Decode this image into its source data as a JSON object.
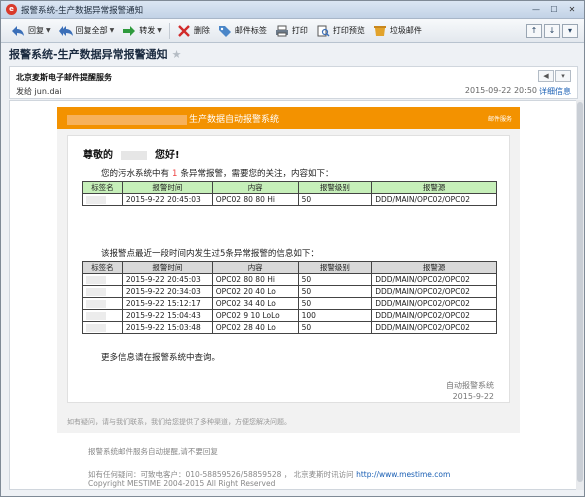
{
  "window": {
    "title": "报警系统-生产数据异常报警通知"
  },
  "toolbar": {
    "reply": "回复",
    "reply_all": "回复全部",
    "forward": "转发",
    "delete": "删除",
    "mail_tag": "邮件标签",
    "print": "打印",
    "print_preview": "打印预览",
    "junk": "垃圾邮件"
  },
  "subject": "报警系统-生产数据异常报警通知",
  "header": {
    "sender": "北京麦斯电子邮件提醒服务",
    "from": "发给 jun.dai",
    "date": "2015-09-22 20:50",
    "details": "详细信息"
  },
  "mail": {
    "header_title": "生产数据自动报警系统",
    "header_right": "邮件服务",
    "greeting_prefix": "尊敬的",
    "greeting_suffix": "您好!",
    "line1_prefix": "您的污水系统中有",
    "line1_count": "1",
    "line1_suffix": "条异常报警，需要您的关注，内容如下：",
    "line2": "该报警点最近一段时间内发生过5条异常报警的信息如下：",
    "more": "更多信息请在报警系统中查询。",
    "sig1": "自动报警系统",
    "sig2": "2015-9-22",
    "faq": "如有疑问，请与我们联系，我们给您提供了多种渠道，方便您解决问题。"
  },
  "table_headers": [
    "标签名",
    "报警时间",
    "内容",
    "报警级别",
    "报警源"
  ],
  "table1": [
    {
      "time": "2015-9-22 20:45:03",
      "content": "OPC02 80 80 Hi",
      "level": "50",
      "source": "DDD/MAIN/OPC02/OPC02"
    }
  ],
  "table2": [
    {
      "time": "2015-9-22 20:45:03",
      "content": "OPC02 80 80 Hi",
      "level": "50",
      "source": "DDD/MAIN/OPC02/OPC02"
    },
    {
      "time": "2015-9-22 20:34:03",
      "content": "OPC02 20 40 Lo",
      "level": "50",
      "source": "DDD/MAIN/OPC02/OPC02"
    },
    {
      "time": "2015-9-22 15:12:17",
      "content": "OPC02 34 40 Lo",
      "level": "50",
      "source": "DDD/MAIN/OPC02/OPC02"
    },
    {
      "time": "2015-9-22 15:04:43",
      "content": "OPC02 9 10 LoLo",
      "level": "100",
      "source": "DDD/MAIN/OPC02/OPC02"
    },
    {
      "time": "2015-9-22 15:03:48",
      "content": "OPC02 28 40 Lo",
      "level": "50",
      "source": "DDD/MAIN/OPC02/OPC02"
    }
  ],
  "footer": {
    "notice": "报警系统邮件服务自动提醒,请不要回复",
    "contact": "如有任何疑问：可致电客户：010-58859526/58859528 ， 北京麦斯时讯访问",
    "url": "http://www.mestime.com",
    "copyright": "Copyright MESTIME 2004-2015 All Right Reserved"
  },
  "colors": {
    "accent": "#f39200",
    "header_row_1": "#c6efb9",
    "header_row_2": "#d9d9d9"
  }
}
